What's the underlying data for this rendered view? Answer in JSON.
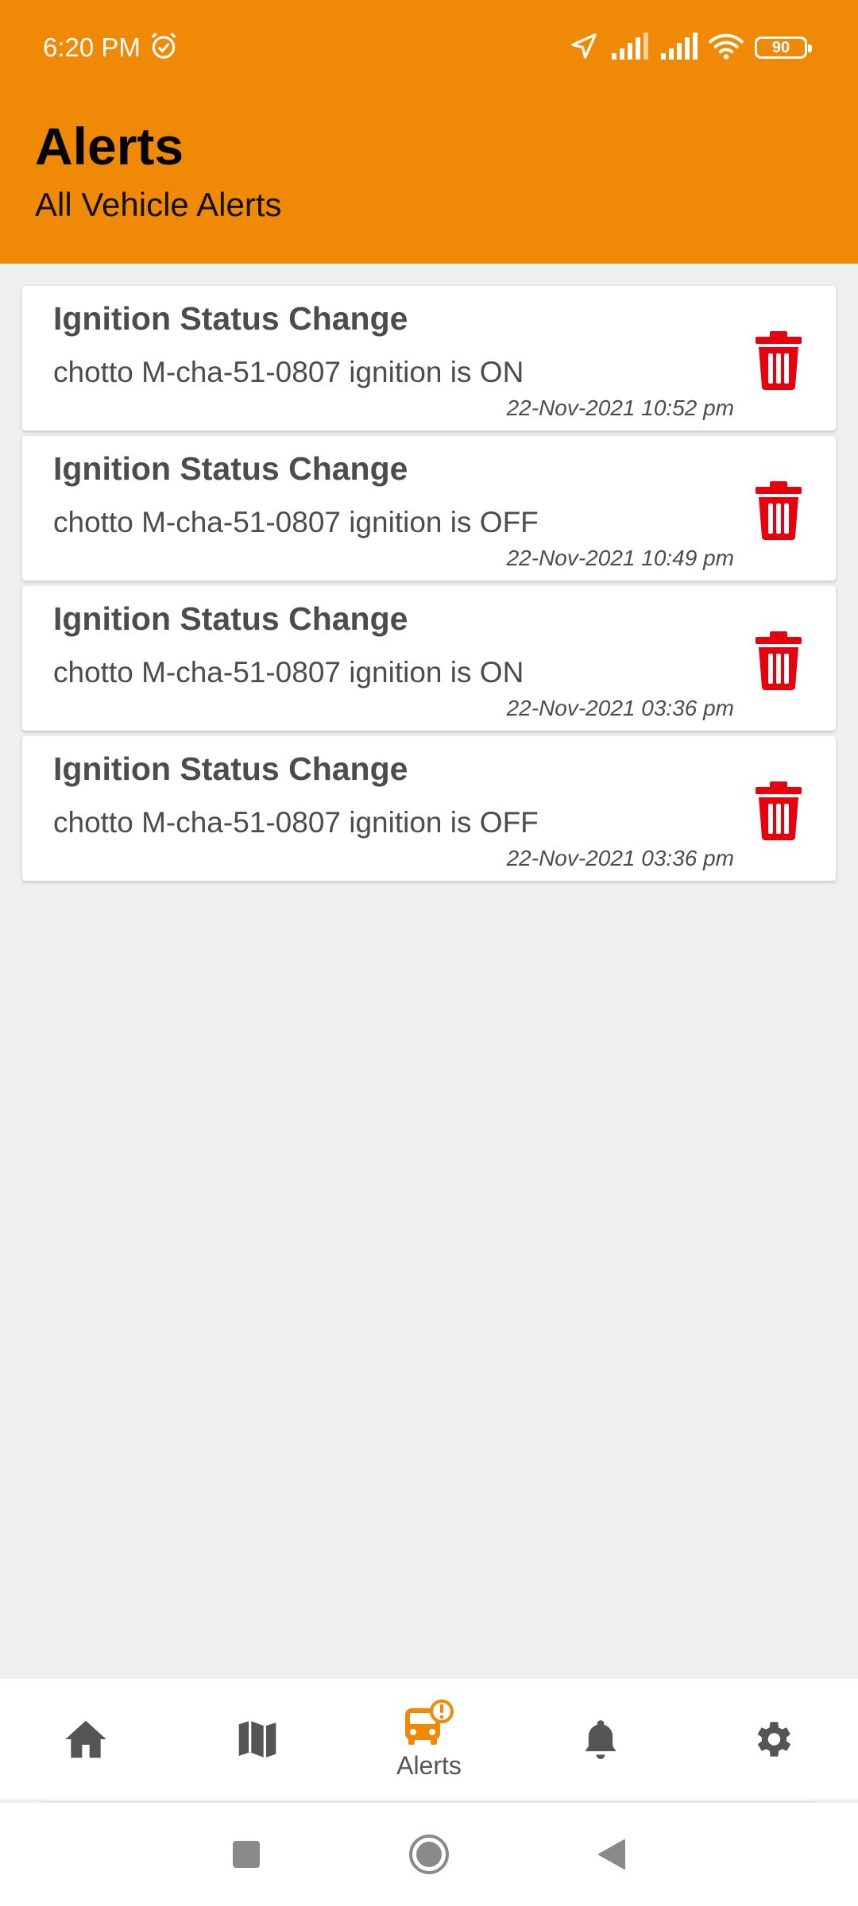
{
  "status_bar": {
    "time": "6:20 PM",
    "battery": "90",
    "icons": [
      "alarm-icon",
      "location-arrow-icon",
      "signal-icon",
      "signal-icon",
      "wifi-icon",
      "battery-icon"
    ]
  },
  "header": {
    "title": "Alerts",
    "subtitle": "All Vehicle Alerts"
  },
  "alerts": [
    {
      "title": "Ignition Status Change",
      "message": "chotto M-cha-51-0807 ignition is ON",
      "time": "22-Nov-2021 10:52 pm"
    },
    {
      "title": "Ignition Status Change",
      "message": "chotto M-cha-51-0807 ignition is OFF",
      "time": "22-Nov-2021 10:49 pm"
    },
    {
      "title": "Ignition Status Change",
      "message": "chotto M-cha-51-0807 ignition is ON",
      "time": "22-Nov-2021 03:36 pm"
    },
    {
      "title": "Ignition Status Change",
      "message": "chotto M-cha-51-0807 ignition is OFF",
      "time": "22-Nov-2021 03:36 pm"
    }
  ],
  "bottom_nav": {
    "items": [
      {
        "icon": "home-icon",
        "label": ""
      },
      {
        "icon": "map-icon",
        "label": ""
      },
      {
        "icon": "bus-alert-icon",
        "label": "Alerts",
        "active": true
      },
      {
        "icon": "bell-icon",
        "label": ""
      },
      {
        "icon": "gear-icon",
        "label": ""
      }
    ]
  },
  "colors": {
    "header_bg": "#f08a06",
    "accent": "#f08a06",
    "delete": "#e8000d",
    "background": "#eef0ef"
  }
}
